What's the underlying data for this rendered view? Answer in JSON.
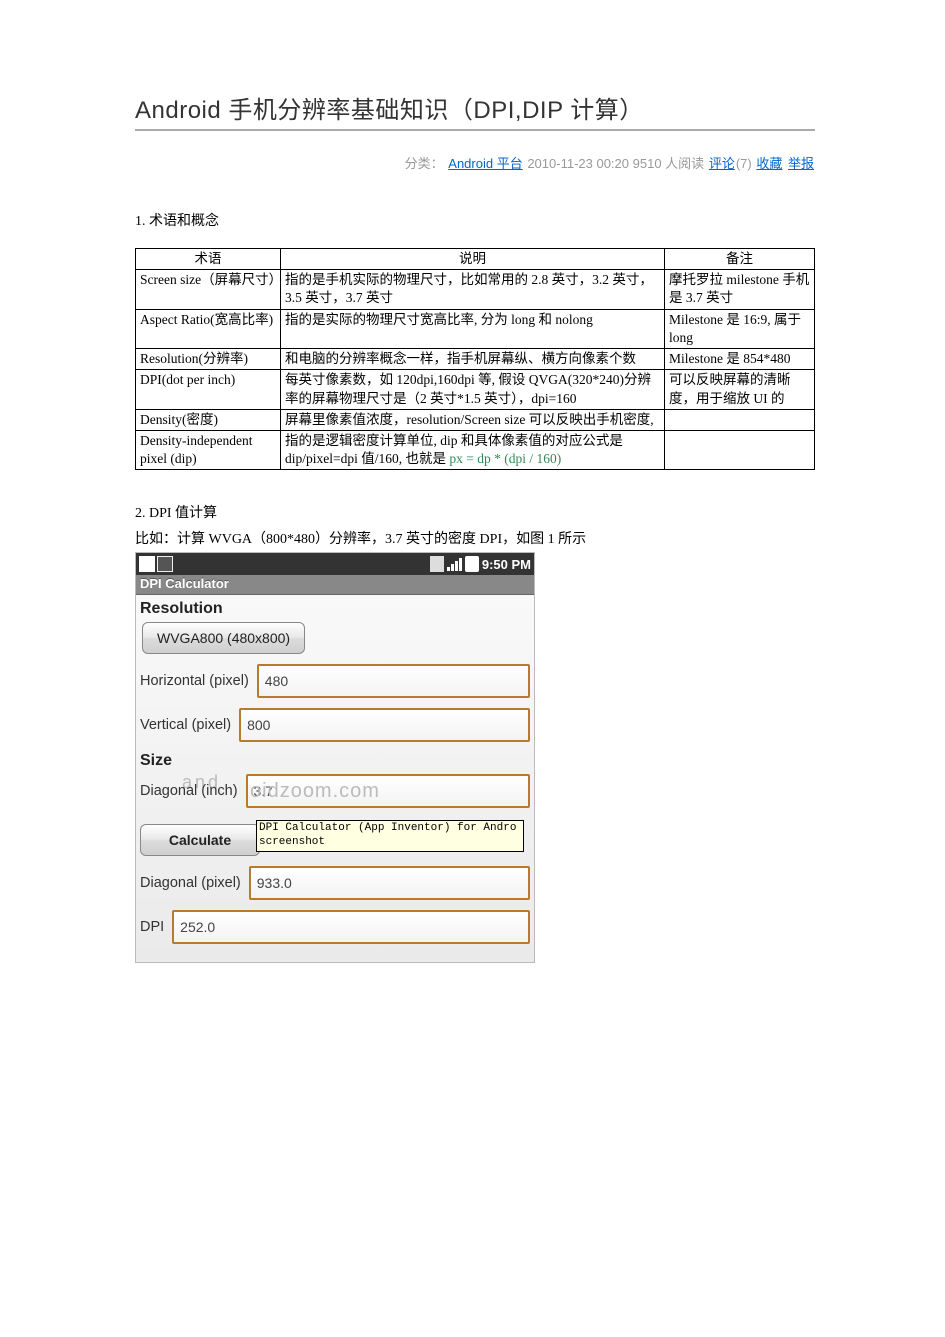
{
  "title": "Android 手机分辨率基础知识（DPI,DIP 计算）",
  "meta": {
    "category_label": "分类：",
    "category_link": "Android 平台",
    "datetime": "2010-11-23 00:20",
    "read_count": "9510 人阅读",
    "comments_link": "评论",
    "comments_count": "(7)",
    "fav_link": "收藏",
    "report_link": "举报"
  },
  "section1_title": "1. 术语和概念",
  "table": {
    "headers": [
      "术语",
      "说明",
      "备注"
    ],
    "rows": [
      {
        "term": "Screen size（屏幕尺寸）",
        "desc": "指的是手机实际的物理尺寸，比如常用的 2.8 英寸，3.2 英寸，3.5 英寸，3.7 英寸",
        "note": "摩托罗拉 milestone 手机是 3.7 英寸"
      },
      {
        "term": "Aspect Ratio(宽高比率)",
        "desc": "指的是实际的物理尺寸宽高比率, 分为 long 和 nolong",
        "note": "Milestone 是 16:9, 属于 long"
      },
      {
        "term": "Resolution(分辨率)",
        "desc": "和电脑的分辨率概念一样，指手机屏幕纵、横方向像素个数",
        "note": "Milestone 是 854*480"
      },
      {
        "term": "DPI(dot per inch)",
        "desc": "每英寸像素数，如 120dpi,160dpi 等, 假设 QVGA(320*240)分辨率的屏幕物理尺寸是（2 英寸*1.5 英寸），dpi=160",
        "note": "可以反映屏幕的清晰度，用于缩放 UI 的"
      },
      {
        "term": "Density(密度)",
        "desc": "屏幕里像素值浓度，resolution/Screen size 可以反映出手机密度,",
        "note": ""
      },
      {
        "term": "Density-independent pixel (dip)",
        "desc": "指的是逻辑密度计算单位, dip 和具体像素值的对应公式是 dip/pixel=dpi 值/160, 也就是",
        "formula": "px = dp * (dpi / 160)",
        "note": ""
      }
    ]
  },
  "section2_title": "2. DPI 值计算",
  "section2_example": "比如：计算 WVGA（800*480）分辨率，3.7 英寸的密度 DPI，如图 1 所示",
  "phone": {
    "status_time": "9:50 PM",
    "app_title": "DPI Calculator",
    "grp_resolution": "Resolution",
    "resolution_btn": "WVGA800 (480x800)",
    "horizontal_label": "Horizontal (pixel)",
    "horizontal_value": "480",
    "vertical_label": "Vertical (pixel)",
    "vertical_value": "800",
    "grp_size": "Size",
    "diagonal_in_label": "Diagonal (inch)",
    "diagonal_in_value": "3.7",
    "watermark_text": "oidzoom.com",
    "watermark_pre": "and",
    "calculate_btn": "Calculate",
    "tooltip_text": "DPI Calculator (App Inventor) for Andro screenshot",
    "diagonal_px_label": "Diagonal (pixel)",
    "diagonal_px_value": "933.0",
    "dpi_label": "DPI",
    "dpi_value": "252.0"
  }
}
